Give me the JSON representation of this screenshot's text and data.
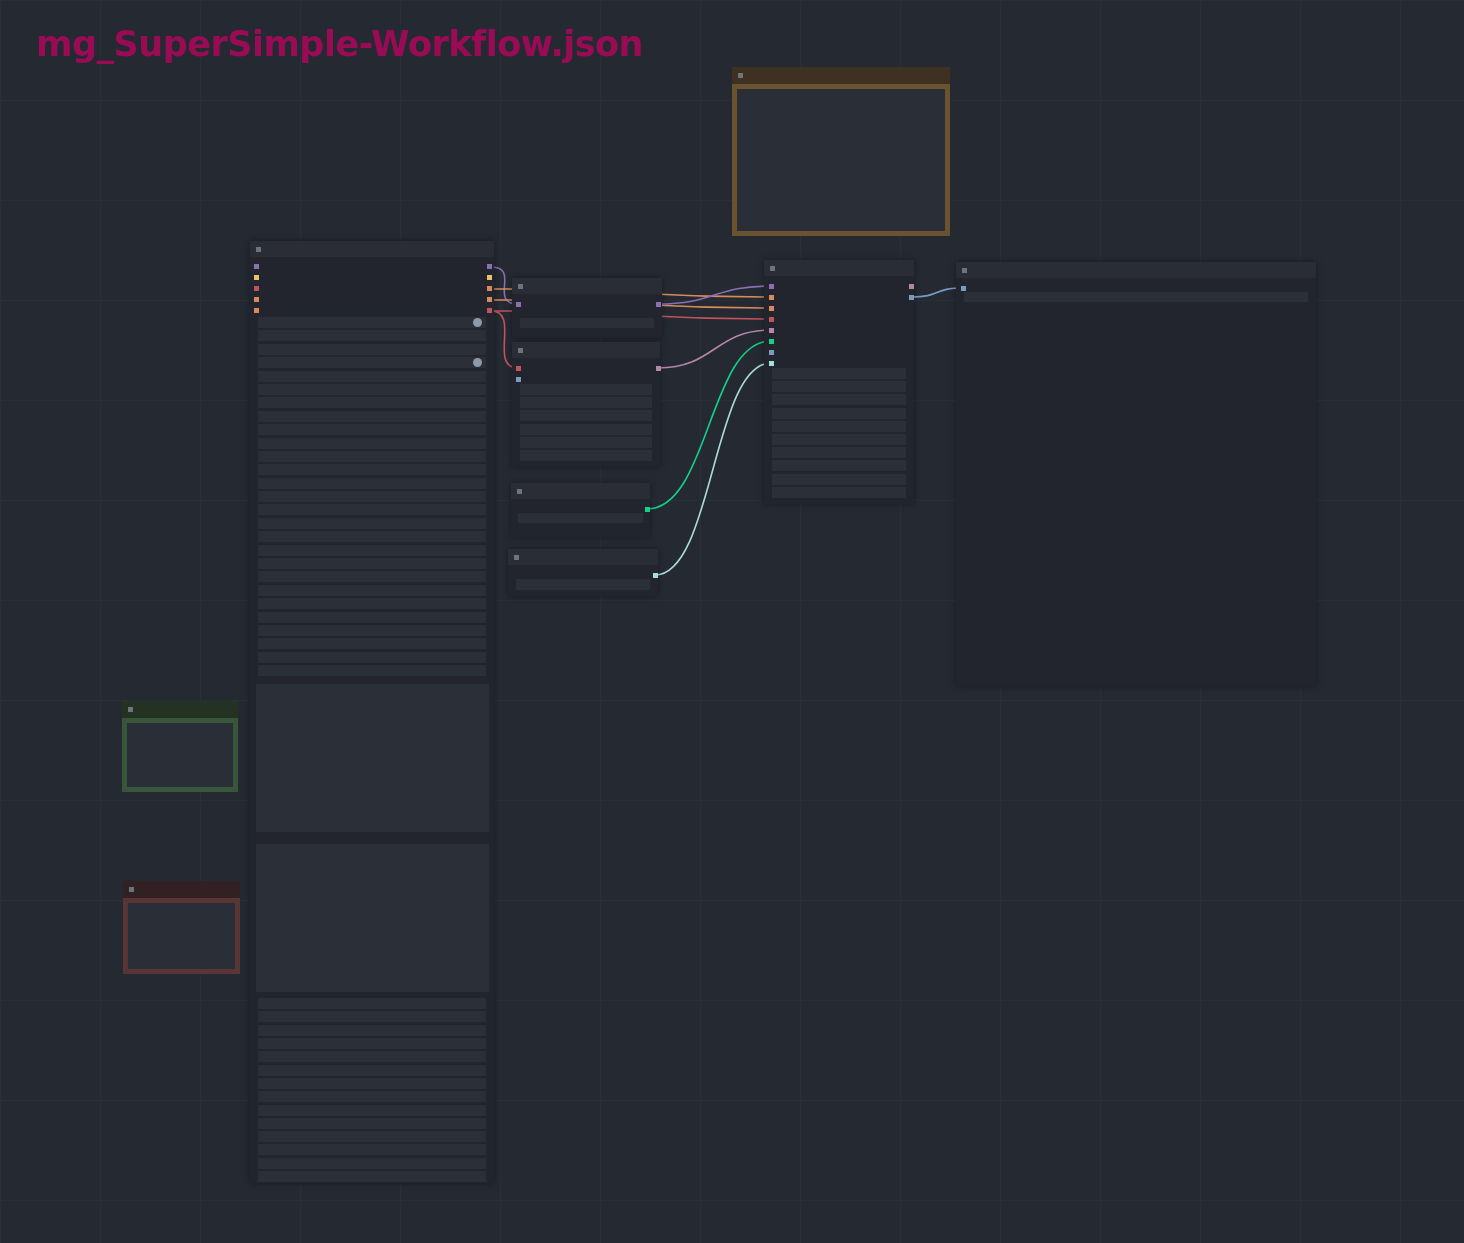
{
  "title": "mg_SuperSimple-Workflow.json"
}
